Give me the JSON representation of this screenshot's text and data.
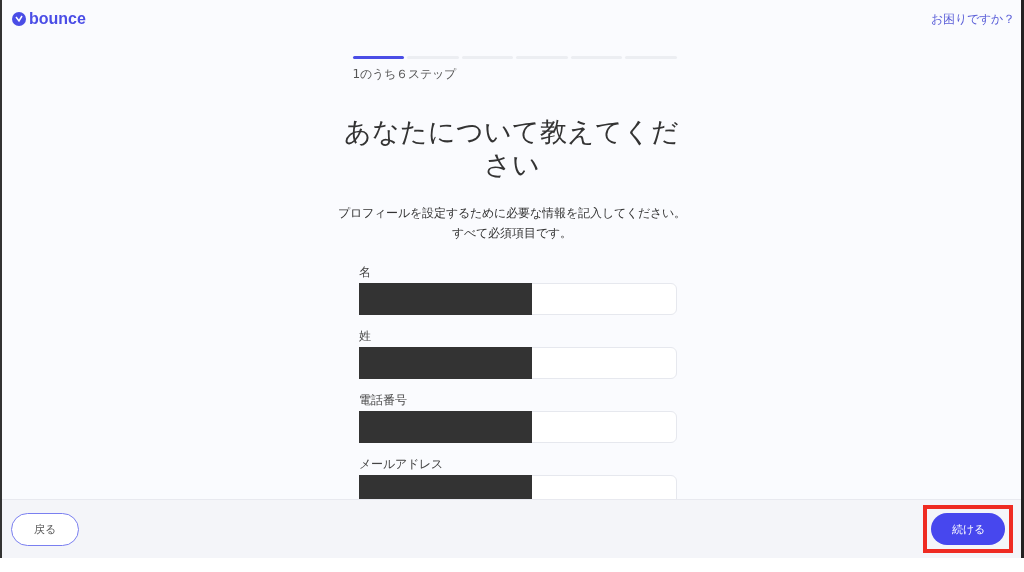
{
  "header": {
    "logo": "bounce",
    "help_link": "お困りですか？"
  },
  "progress": {
    "steps": [
      {
        "selected": true
      },
      {
        "selected": false
      },
      {
        "selected": false
      },
      {
        "selected": false
      },
      {
        "selected": false
      },
      {
        "selected": false
      }
    ],
    "label": "1のうち６ステップ"
  },
  "title": "あなたについて教えてください",
  "description": "プロフィールを設定するために必要な情報を記入してください。すべて必須項目です。",
  "fields": [
    {
      "label": "名",
      "redacted": true
    },
    {
      "label": "姓",
      "redacted": true
    },
    {
      "label": "電話番号",
      "redacted": true
    },
    {
      "label": "メールアドレス",
      "redacted": true
    }
  ],
  "footer": {
    "back": "戻る",
    "continue": "続ける",
    "continue_highlighted": true
  }
}
